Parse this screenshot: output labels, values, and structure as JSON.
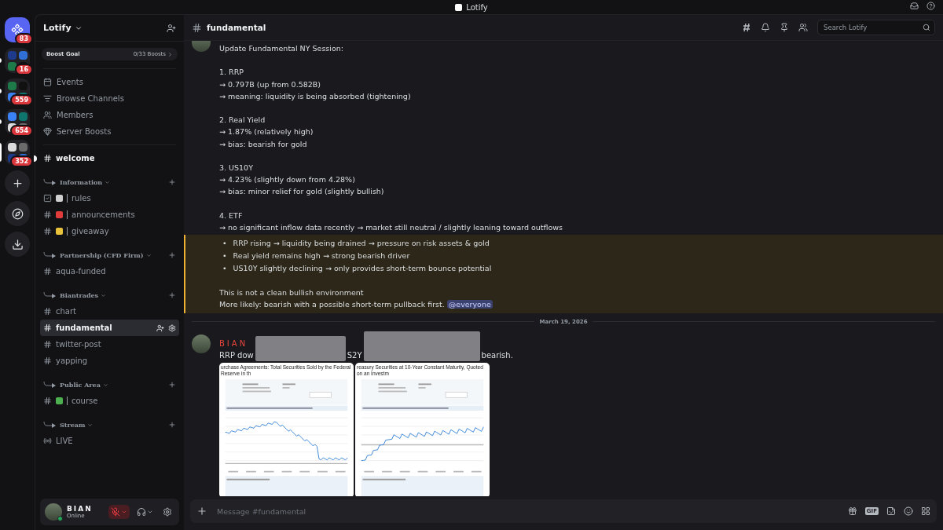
{
  "window": {
    "title": "Lotify"
  },
  "servers": [
    {
      "badge": "83",
      "kind": "home"
    },
    {
      "badge": "16",
      "kind": "folder",
      "selected": false,
      "unread": true
    },
    {
      "badge": "559",
      "kind": "folder",
      "selected": false,
      "unread": true
    },
    {
      "badge": "654",
      "kind": "folder",
      "selected": false,
      "unread": true
    },
    {
      "badge": "352",
      "kind": "folder",
      "selected": true,
      "unread": false
    },
    {
      "kind": "add"
    },
    {
      "kind": "discover"
    },
    {
      "kind": "download"
    }
  ],
  "server": {
    "name": "Lotify",
    "boost": {
      "label": "Boost Goal",
      "count": "0/33 Boosts"
    },
    "links": [
      {
        "kind": "events",
        "label": "Events"
      },
      {
        "kind": "browse",
        "label": "Browse Channels"
      },
      {
        "kind": "members",
        "label": "Members"
      },
      {
        "kind": "boosts",
        "label": "Server Boosts"
      }
    ],
    "channels": [
      {
        "kind": "text",
        "name": "welcome",
        "unread": true,
        "selected": false
      }
    ],
    "categories": [
      {
        "name": "Information",
        "channels": [
          {
            "kind": "rules",
            "name": "rules",
            "color": "#d0d0d0",
            "unread": false,
            "selected": false
          },
          {
            "kind": "text",
            "name": "announcements",
            "color": "#e23b3b",
            "unread": false,
            "selected": false
          },
          {
            "kind": "text",
            "name": "giveaway",
            "color": "#e8c23a",
            "unread": false,
            "selected": false
          }
        ]
      },
      {
        "name": "Partnership (CFD Firm)",
        "channels": [
          {
            "kind": "text",
            "name": "aqua-funded",
            "unread": false,
            "selected": false
          }
        ]
      },
      {
        "name": "Biantrades",
        "channels": [
          {
            "kind": "text",
            "name": "chart",
            "unread": false,
            "selected": false
          },
          {
            "kind": "text",
            "name": "fundamental",
            "unread": false,
            "selected": true
          },
          {
            "kind": "text",
            "name": "twitter-post",
            "unread": false,
            "selected": false
          },
          {
            "kind": "text",
            "name": "yapping",
            "unread": false,
            "selected": false
          }
        ]
      },
      {
        "name": "Public Area",
        "channels": [
          {
            "kind": "text",
            "name": "course",
            "color": "#4caf50",
            "unread": false,
            "selected": false
          }
        ]
      },
      {
        "name": "Stream",
        "channels": [
          {
            "kind": "stage",
            "name": "LIVE",
            "unread": false,
            "selected": false
          }
        ]
      }
    ]
  },
  "user": {
    "name": "BIAN",
    "status": "Online",
    "muted": true
  },
  "channel_header": {
    "name": "fundamental",
    "search": {
      "placeholder": "Search Lotify"
    }
  },
  "messages": [
    {
      "kind": "continued",
      "mention": false,
      "paragraphs": [
        [
          "Update Fundamental NY Session:"
        ],
        [
          "1. RRP",
          "→ 0.797B (up from 0.582B)",
          "→ meaning: liquidity is being absorbed (tightening)"
        ],
        [
          "2. Real Yield",
          "→ 1.87% (relatively high)",
          "→ bias: bearish for gold"
        ],
        [
          "3. US10Y",
          "→ 4.23% (slightly down from 4.28%)",
          "→ bias: minor relief for gold (slightly bullish)"
        ],
        [
          "4. ETF",
          "→ no significant inflow data recently → market still neutral / slightly leaning toward outflows"
        ]
      ]
    },
    {
      "kind": "continued",
      "mention": true,
      "bullets": [
        {
          "marker": "•",
          "text": "RRP rising → liquidity being drained → pressure on risk assets & gold"
        },
        {
          "marker": "•",
          "text": "Real yield remains high → strong bearish driver"
        },
        {
          "marker": "•",
          "text": "US10Y slightly declining → only provides short-term bounce potential"
        }
      ],
      "paragraphs": [
        [
          "This is not a clean bullish environment",
          "More likely: bearish with a possible short-term pullback first."
        ]
      ],
      "mention_text": "@everyone"
    },
    {
      "kind": "divider",
      "date": "March 19, 2026"
    },
    {
      "kind": "full",
      "author": "BIAN",
      "redacted": true,
      "text_parts": [
        "RRP dow",
        "S2Y",
        "bearish."
      ],
      "attachments": [
        {
          "title": "urchase Agreements: Total Securities Sold by the Federal Reserve in th"
        },
        {
          "title": "reasury Securities at 10-Year Constant Maturity, Quoted on an Investm"
        }
      ]
    }
  ],
  "composer": {
    "placeholder": "Message #fundamental",
    "gif_label": "GIF"
  }
}
